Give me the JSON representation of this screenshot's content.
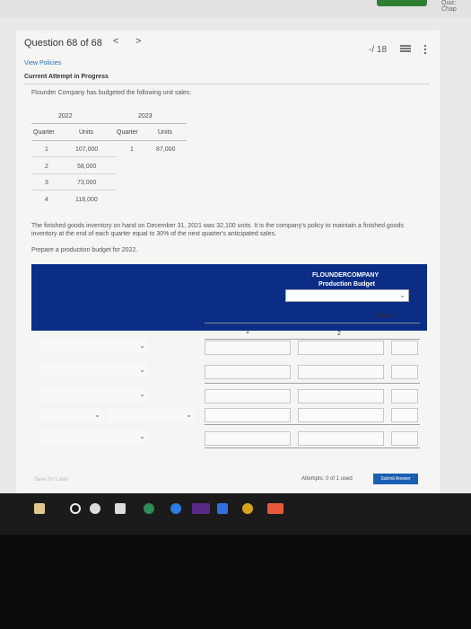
{
  "top": {
    "right_link": "Quiz: Chap"
  },
  "header": {
    "question": "Question 68 of 68",
    "prev": "<",
    "next": ">",
    "points": "-/ 18"
  },
  "links": {
    "view_policies": "View Policies"
  },
  "status": "Current Attempt in Progress",
  "intro": "Flounder Company has budgeted the following unit sales:",
  "sales_table": {
    "year1": "2022",
    "year2": "2023",
    "col_quarter": "Quarter",
    "col_units": "Units",
    "rows_2022": [
      {
        "quarter": "1",
        "units": "107,000"
      },
      {
        "quarter": "2",
        "units": "58,000"
      },
      {
        "quarter": "3",
        "units": "73,000"
      },
      {
        "quarter": "4",
        "units": "118,000"
      }
    ],
    "row_2023": {
      "quarter": "1",
      "units": "87,000"
    }
  },
  "paragraph": "The finished goods inventory on hand on December 31, 2021 was 32,100 units. It is the company's policy to maintain a finished goods inventory at the end of each quarter equal to 30% of the next quarter's anticipated sales.",
  "instruction": "Prepare a production budget for 2022.",
  "budget": {
    "company": "FLOUNDERCOMPANY",
    "title": "Production Budget",
    "quarter_label": "Quarter",
    "col1": "1",
    "col2": "2"
  },
  "footer": {
    "save": "Save for Later",
    "attempts": "Attempts: 0 of 1 used",
    "submit": "Submit Answer"
  },
  "colors": {
    "budget_bg": "#0b2d86",
    "submit": "#1a5fb4",
    "link": "#2a6fb5"
  }
}
